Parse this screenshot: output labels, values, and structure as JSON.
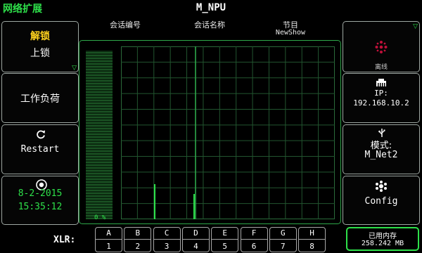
{
  "header": {
    "brand": "网络扩展",
    "title": "M_NPU"
  },
  "columns": {
    "session_id": "会话编号",
    "session_name": "会话名称",
    "program": "节目",
    "program_value": "NewShow"
  },
  "left_panels": {
    "lock": {
      "active": "解锁",
      "inactive": "上锁"
    },
    "workload": {
      "label": "工作负荷"
    },
    "restart": {
      "label": "Restart"
    },
    "clock": {
      "date": "8-2-2015",
      "time": "15:35:12"
    }
  },
  "right_panels": {
    "status": {
      "label": "离线"
    },
    "network": {
      "label": "IP:",
      "ip": "192.168.10.2"
    },
    "mode": {
      "label": "模式:",
      "value": "M_Net2"
    },
    "config": {
      "label": "Config"
    }
  },
  "meter": {
    "percent_label": "0 %"
  },
  "xlr": {
    "label": "XLR:",
    "channels": [
      {
        "letter": "A",
        "number": "1"
      },
      {
        "letter": "B",
        "number": "2"
      },
      {
        "letter": "C",
        "number": "3"
      },
      {
        "letter": "D",
        "number": "4"
      },
      {
        "letter": "E",
        "number": "5"
      },
      {
        "letter": "F",
        "number": "6"
      },
      {
        "letter": "G",
        "number": "7"
      },
      {
        "letter": "H",
        "number": "8"
      }
    ]
  },
  "memory": {
    "label": "已用内存",
    "value": "258.242 MB"
  },
  "colors": {
    "accent_green": "#2ee04a",
    "lock_yellow": "#ffd21e",
    "status_red": "#c0103a",
    "grid_green": "#2a6a3a"
  },
  "icons": [
    "refresh-icon",
    "power-icon",
    "network-status-icon",
    "ethernet-icon",
    "usb-icon",
    "settings-icon"
  ]
}
